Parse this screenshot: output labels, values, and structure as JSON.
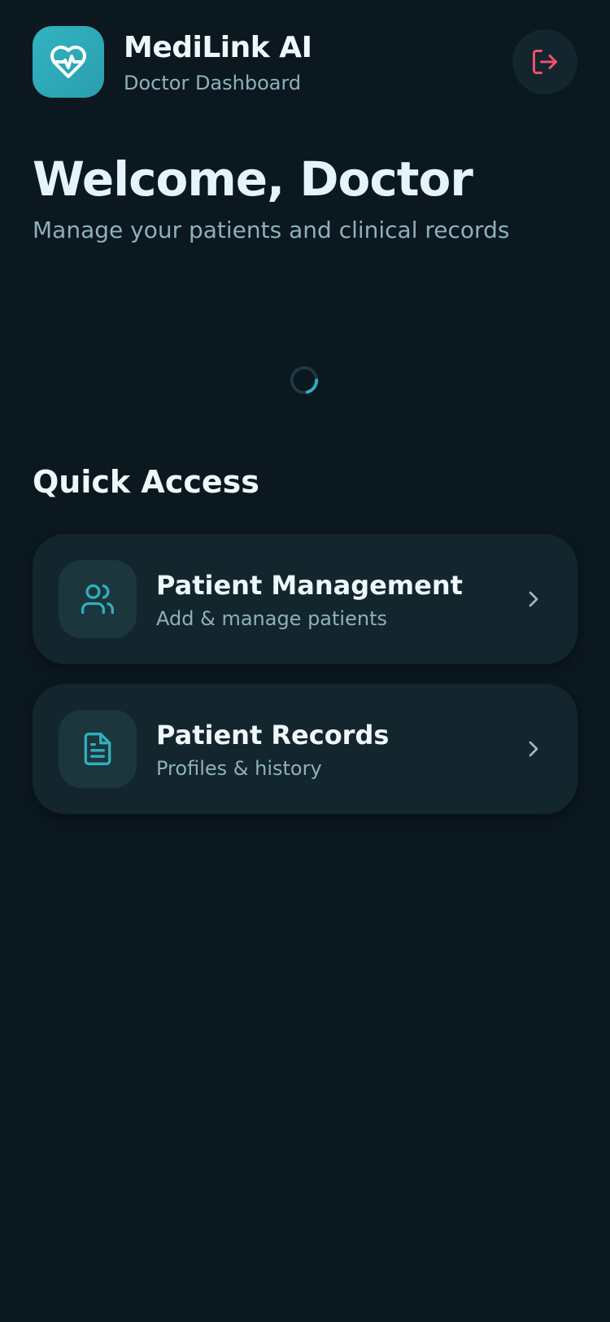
{
  "header": {
    "app_name": "MediLink AI",
    "app_subtitle": "Doctor Dashboard",
    "logo_icon": "heart-pulse-icon",
    "logout_icon": "log-out-icon"
  },
  "welcome": {
    "title": "Welcome, Doctor",
    "subtitle": "Manage your patients and clinical records"
  },
  "quick_access": {
    "title": "Quick Access",
    "cards": [
      {
        "title": "Patient Management",
        "subtitle": "Add & manage patients",
        "icon": "users-icon"
      },
      {
        "title": "Patient Records",
        "subtitle": "Profiles & history",
        "icon": "file-text-icon"
      }
    ]
  },
  "colors": {
    "background": "#0b1820",
    "card": "#13252d",
    "accent": "#2fb0bd",
    "danger": "#f0506e",
    "muted_text": "#8fb0ba"
  }
}
